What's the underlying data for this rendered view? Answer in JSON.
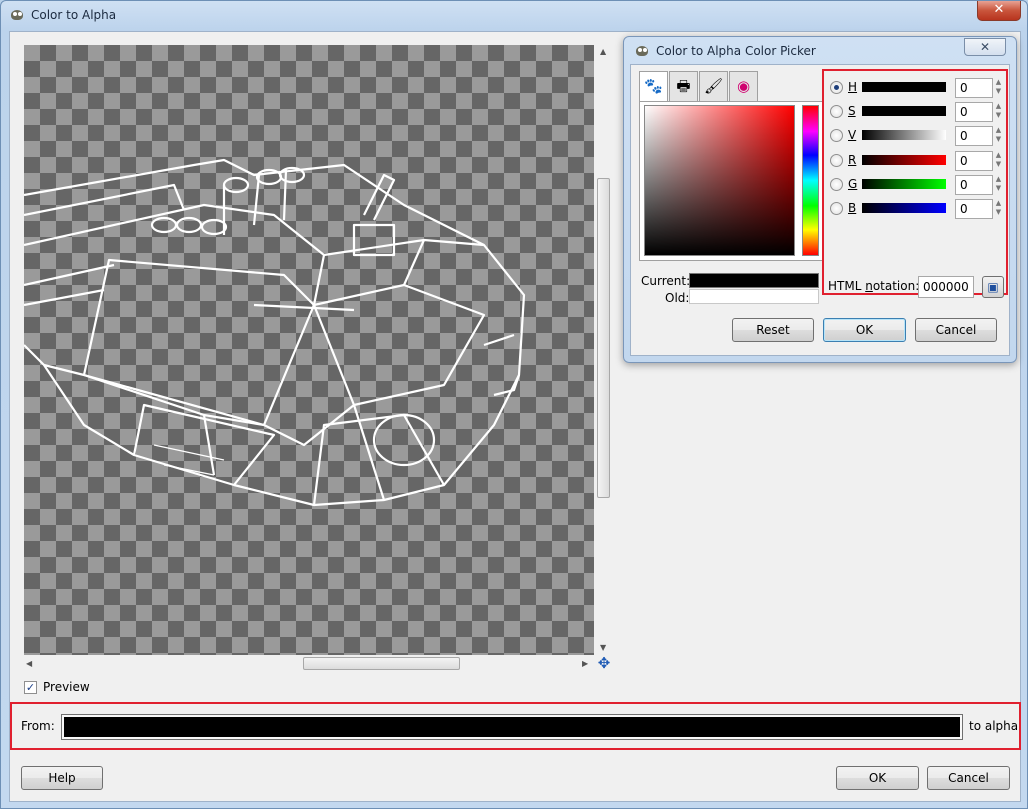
{
  "window": {
    "title": "Color to Alpha",
    "close_glyph": "✕"
  },
  "preview": {
    "checkbox_label": "Preview",
    "checked": true,
    "checkmark": "✓"
  },
  "from_row": {
    "label": "From:",
    "suffix": "to alpha",
    "color": "#000000"
  },
  "buttons": {
    "help": "Help",
    "ok": "OK",
    "cancel": "Cancel"
  },
  "picker_dialog": {
    "title": "Color to Alpha Color Picker",
    "close_glyph": "✕",
    "current_label": "Current:",
    "old_label": "Old:",
    "sliders": [
      {
        "label": "H",
        "value": "0",
        "selected": true
      },
      {
        "label": "S",
        "value": "0",
        "selected": false
      },
      {
        "label": "V",
        "value": "0",
        "selected": false
      },
      {
        "label": "R",
        "value": "0",
        "selected": false
      },
      {
        "label": "G",
        "value": "0",
        "selected": false
      },
      {
        "label": "B",
        "value": "0",
        "selected": false
      }
    ],
    "html_label_pre": "HTML ",
    "html_label_u": "n",
    "html_label_post": "otation:",
    "html_value": "000000",
    "buttons": {
      "reset": "Reset",
      "ok": "OK",
      "cancel": "Cancel"
    },
    "tabs": [
      "gimp-tab-icon",
      "printer-tab-icon",
      "brush-tab-icon",
      "color-wheel-tab-icon"
    ]
  },
  "colors": {
    "highlight": "#e0202f",
    "current_color": "#000000",
    "old_color": "#ffffff"
  }
}
